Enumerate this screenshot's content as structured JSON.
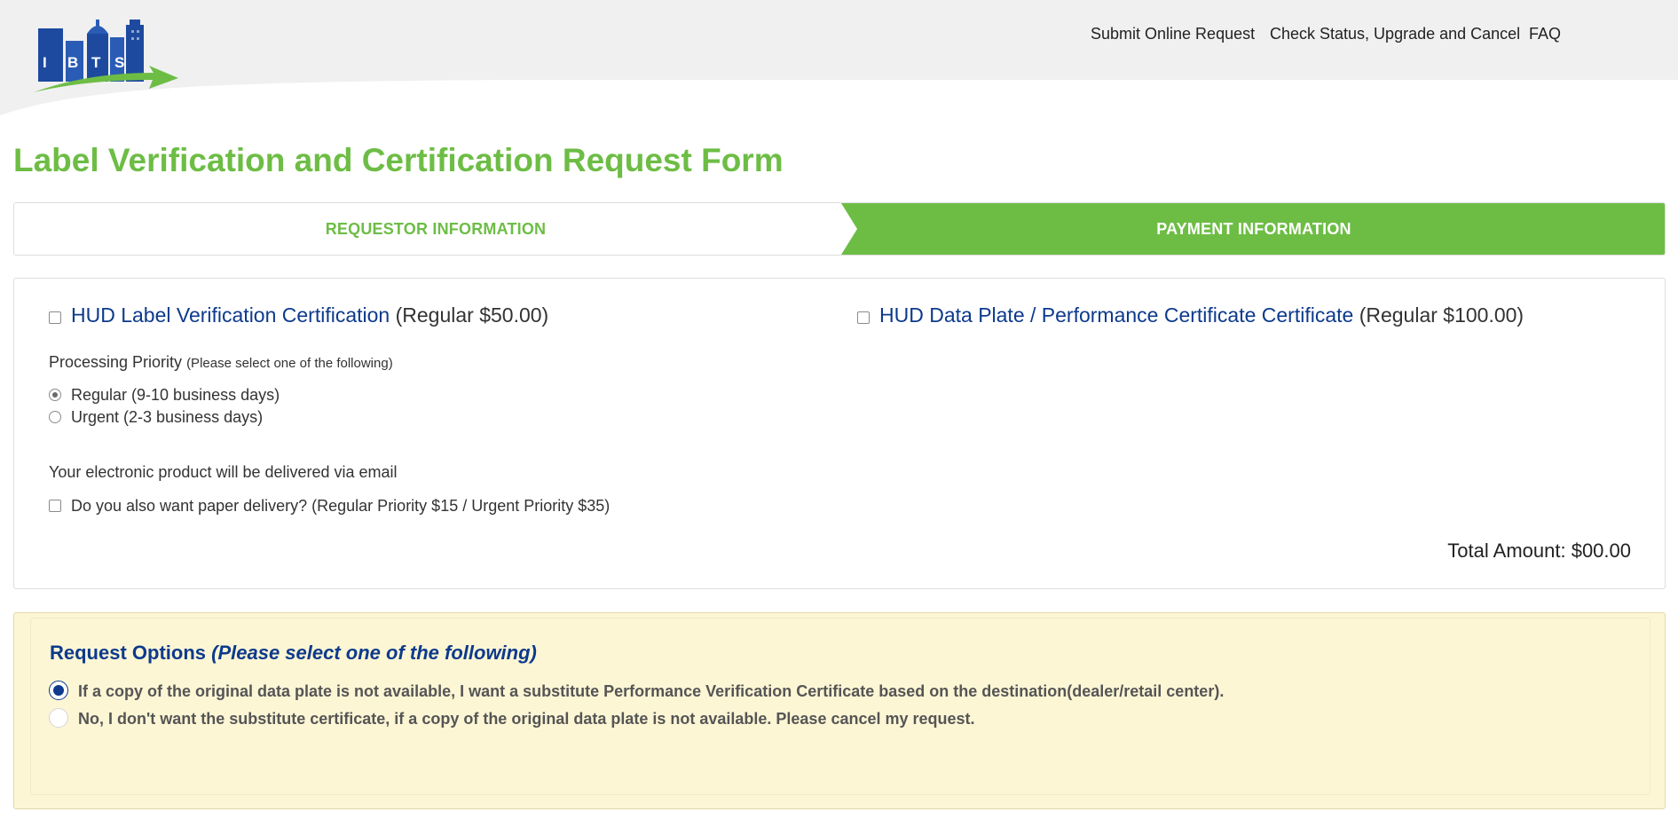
{
  "nav": {
    "logo_letters": [
      "I",
      "B",
      "T",
      "S"
    ],
    "links": [
      "Submit Online Request",
      "Check Status, Upgrade and Cancel",
      "FAQ"
    ]
  },
  "page": {
    "title": "Label Verification and Certification Request Form"
  },
  "steps": {
    "step1": "REQUESTOR INFORMATION",
    "step2": "PAYMENT INFORMATION",
    "active_color": "#6dbd45"
  },
  "payment": {
    "product1": {
      "name": "HUD Label Verification Certification",
      "price": "(Regular $50.00)",
      "checked": false
    },
    "product2": {
      "name": "HUD Data Plate / Performance Certificate Certificate",
      "price": "(Regular $100.00)",
      "checked": false
    },
    "priority_label": "Processing Priority",
    "priority_hint": "(Please select one of the following)",
    "priority_options": [
      {
        "label": "Regular (9-10 business days)",
        "checked": true
      },
      {
        "label": "Urgent (2-3 business days)",
        "checked": false
      }
    ],
    "delivery_note": "Your electronic product will be delivered via email",
    "paper_delivery": "Do you also want paper delivery? (Regular Priority $15 / Urgent Priority $35)",
    "total": "Total Amount: $00.00"
  },
  "request_options": {
    "title": "Request Options",
    "title_hint": "(Please select one of the following)",
    "options": [
      {
        "label": "If a copy of the original data plate is not available, I want a substitute Performance Verification Certificate based on the destination(dealer/retail center).",
        "checked": true
      },
      {
        "label": "No, I don't want the substitute certificate, if a copy of the original data plate is not available. Please cancel my request.",
        "checked": false
      }
    ]
  },
  "colors": {
    "brand_green": "#6dbd45",
    "brand_blue": "#0d3a8c",
    "options_bg": "#fdf6d5"
  }
}
